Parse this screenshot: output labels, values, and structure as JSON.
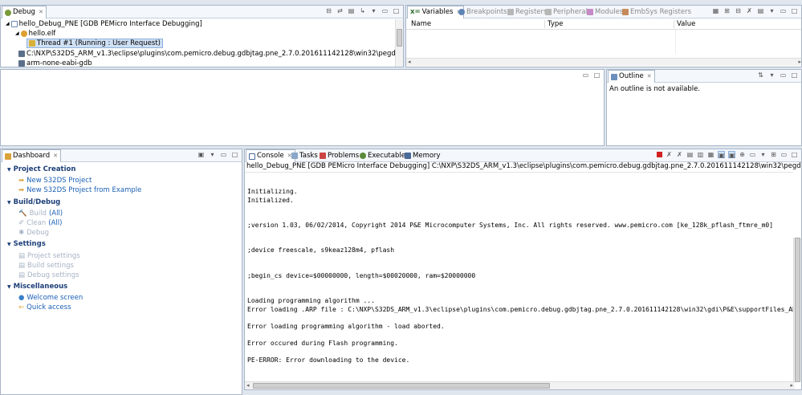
{
  "debug_view": {
    "tab_label": "Debug",
    "tree": [
      "hello_Debug_PNE [GDB PEMicro Interface Debugging]",
      "hello.elf",
      "Thread #1 (Running : User Request)",
      "C:\\NXP\\S32DS_ARM_v1.3\\eclipse\\plugins\\com.pemicro.debug.gdbjtag.pne_2.7.0.201611142128\\win32\\pegdbserver_console",
      "arm-none-eabi-gdb"
    ]
  },
  "variables_view": {
    "tabs": [
      "Variables",
      "Breakpoints",
      "Registers",
      "Peripherals",
      "Modules",
      "EmbSys Registers"
    ],
    "columns": [
      "Name",
      "Type",
      "Value"
    ]
  },
  "outline_view": {
    "tab_label": "Outline",
    "message": "An outline is not available."
  },
  "dashboard": {
    "tab_label": "Dashboard",
    "sections": [
      {
        "title": "Project Creation",
        "items": [
          "New S32DS Project",
          "New S32DS Project from Example"
        ]
      },
      {
        "title": "Build/Debug",
        "items": [
          "Build",
          "Clean",
          "Debug"
        ],
        "all_label": "(All)"
      },
      {
        "title": "Settings",
        "items": [
          "Project settings",
          "Build settings",
          "Debug settings"
        ]
      },
      {
        "title": "Miscellaneous",
        "items": [
          "Welcome screen",
          "Quick access"
        ]
      }
    ]
  },
  "console_view": {
    "tabs": [
      "Console",
      "Tasks",
      "Problems",
      "Executables",
      "Memory"
    ],
    "header": "hello_Debug_PNE [GDB PEMicro Interface Debugging] C:\\NXP\\S32DS_ARM_v1.3\\eclipse\\plugins\\com.pemicro.debug.gdbjtag.pne_2.7.0.201611142128\\win32\\pegdbserver_console",
    "lines": [
      "Initializing.",
      "Initialized.",
      ";version 1.03, 06/02/2014, Copyright 2014 P&E Microcomputer Systems, Inc. All rights reserved. www.pemicro.com [ke_128k_pflash_ftmre_m0]",
      ";device freescale, s9keaz128m4, pflash",
      ";begin_cs device=$00000000, length=$00020000, ram=$20000000",
      "Loading programming algorithm ...",
      "Error loading .ARP file : C:\\NXP\\S32DS_ARM_v1.3\\eclipse\\plugins\\com.pemicro.debug.gdbjtag.pne_2.7.0.201611142128\\win32\\gdi\\P&E\\supportFiles_ARM\\NX",
      "Error loading programming algorithm - load aborted.",
      "Error occured during Flash programming.",
      "PE-ERROR: Error downloading to the device."
    ]
  },
  "colors": {
    "link": "#1a5fb4",
    "disabled": "#a7b3c4",
    "heading": "#1d3f78",
    "terminate_red": "#d22020",
    "pane_border": "#a9b7c9"
  }
}
